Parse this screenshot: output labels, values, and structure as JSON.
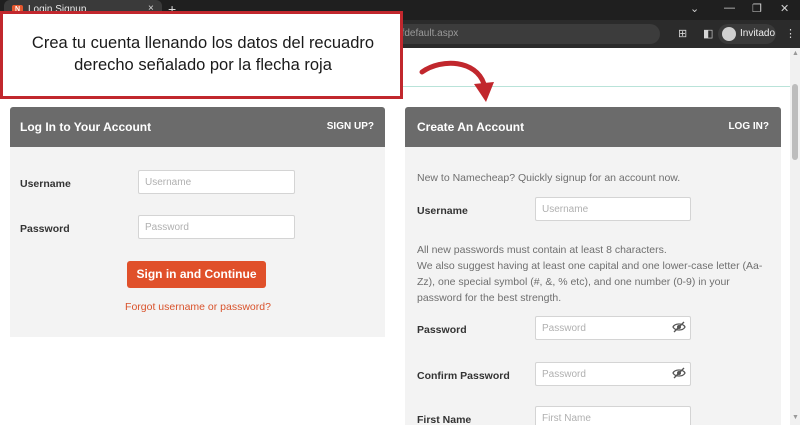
{
  "browser": {
    "tab_title": "Login Signup",
    "favicon_letter": "N",
    "tab_close": "×",
    "new_tab": "+",
    "url_fragment": "?fdefault.aspx",
    "profile_label": "Invitado",
    "menu_dots": "⋮",
    "window_controls": [
      "⌄",
      "—",
      "❐",
      "✕"
    ]
  },
  "annotation": {
    "text": "Crea tu cuenta llenando los datos del recuadro derecho señalado por la flecha roja",
    "color": "#c1272d"
  },
  "login": {
    "title": "Log In to Your Account",
    "signup_link": "SIGN UP?",
    "username_label": "Username",
    "username_placeholder": "Username",
    "password_label": "Password",
    "password_placeholder": "Password",
    "submit_label": "Sign in and Continue",
    "forgot_label": "Forgot username or password?"
  },
  "signup": {
    "title": "Create An Account",
    "login_link": "LOG IN?",
    "intro": "New to Namecheap? Quickly signup for an account now.",
    "username_label": "Username",
    "username_placeholder": "Username",
    "password_rules": "All new passwords must contain at least 8 characters.",
    "password_suggestion": "We also suggest having at least one capital and one lower-case letter (Aa-Zz), one special symbol (#, &, % etc), and one number (0-9) in your password for the best strength.",
    "password_label": "Password",
    "password_placeholder": "Password",
    "confirm_label": "Confirm Password",
    "confirm_placeholder": "Password",
    "firstname_label": "First Name",
    "firstname_placeholder": "First Name"
  },
  "colors": {
    "accent": "#e0502a",
    "panel_header": "#6b6b6b",
    "panel_body": "#f3f3f3"
  }
}
